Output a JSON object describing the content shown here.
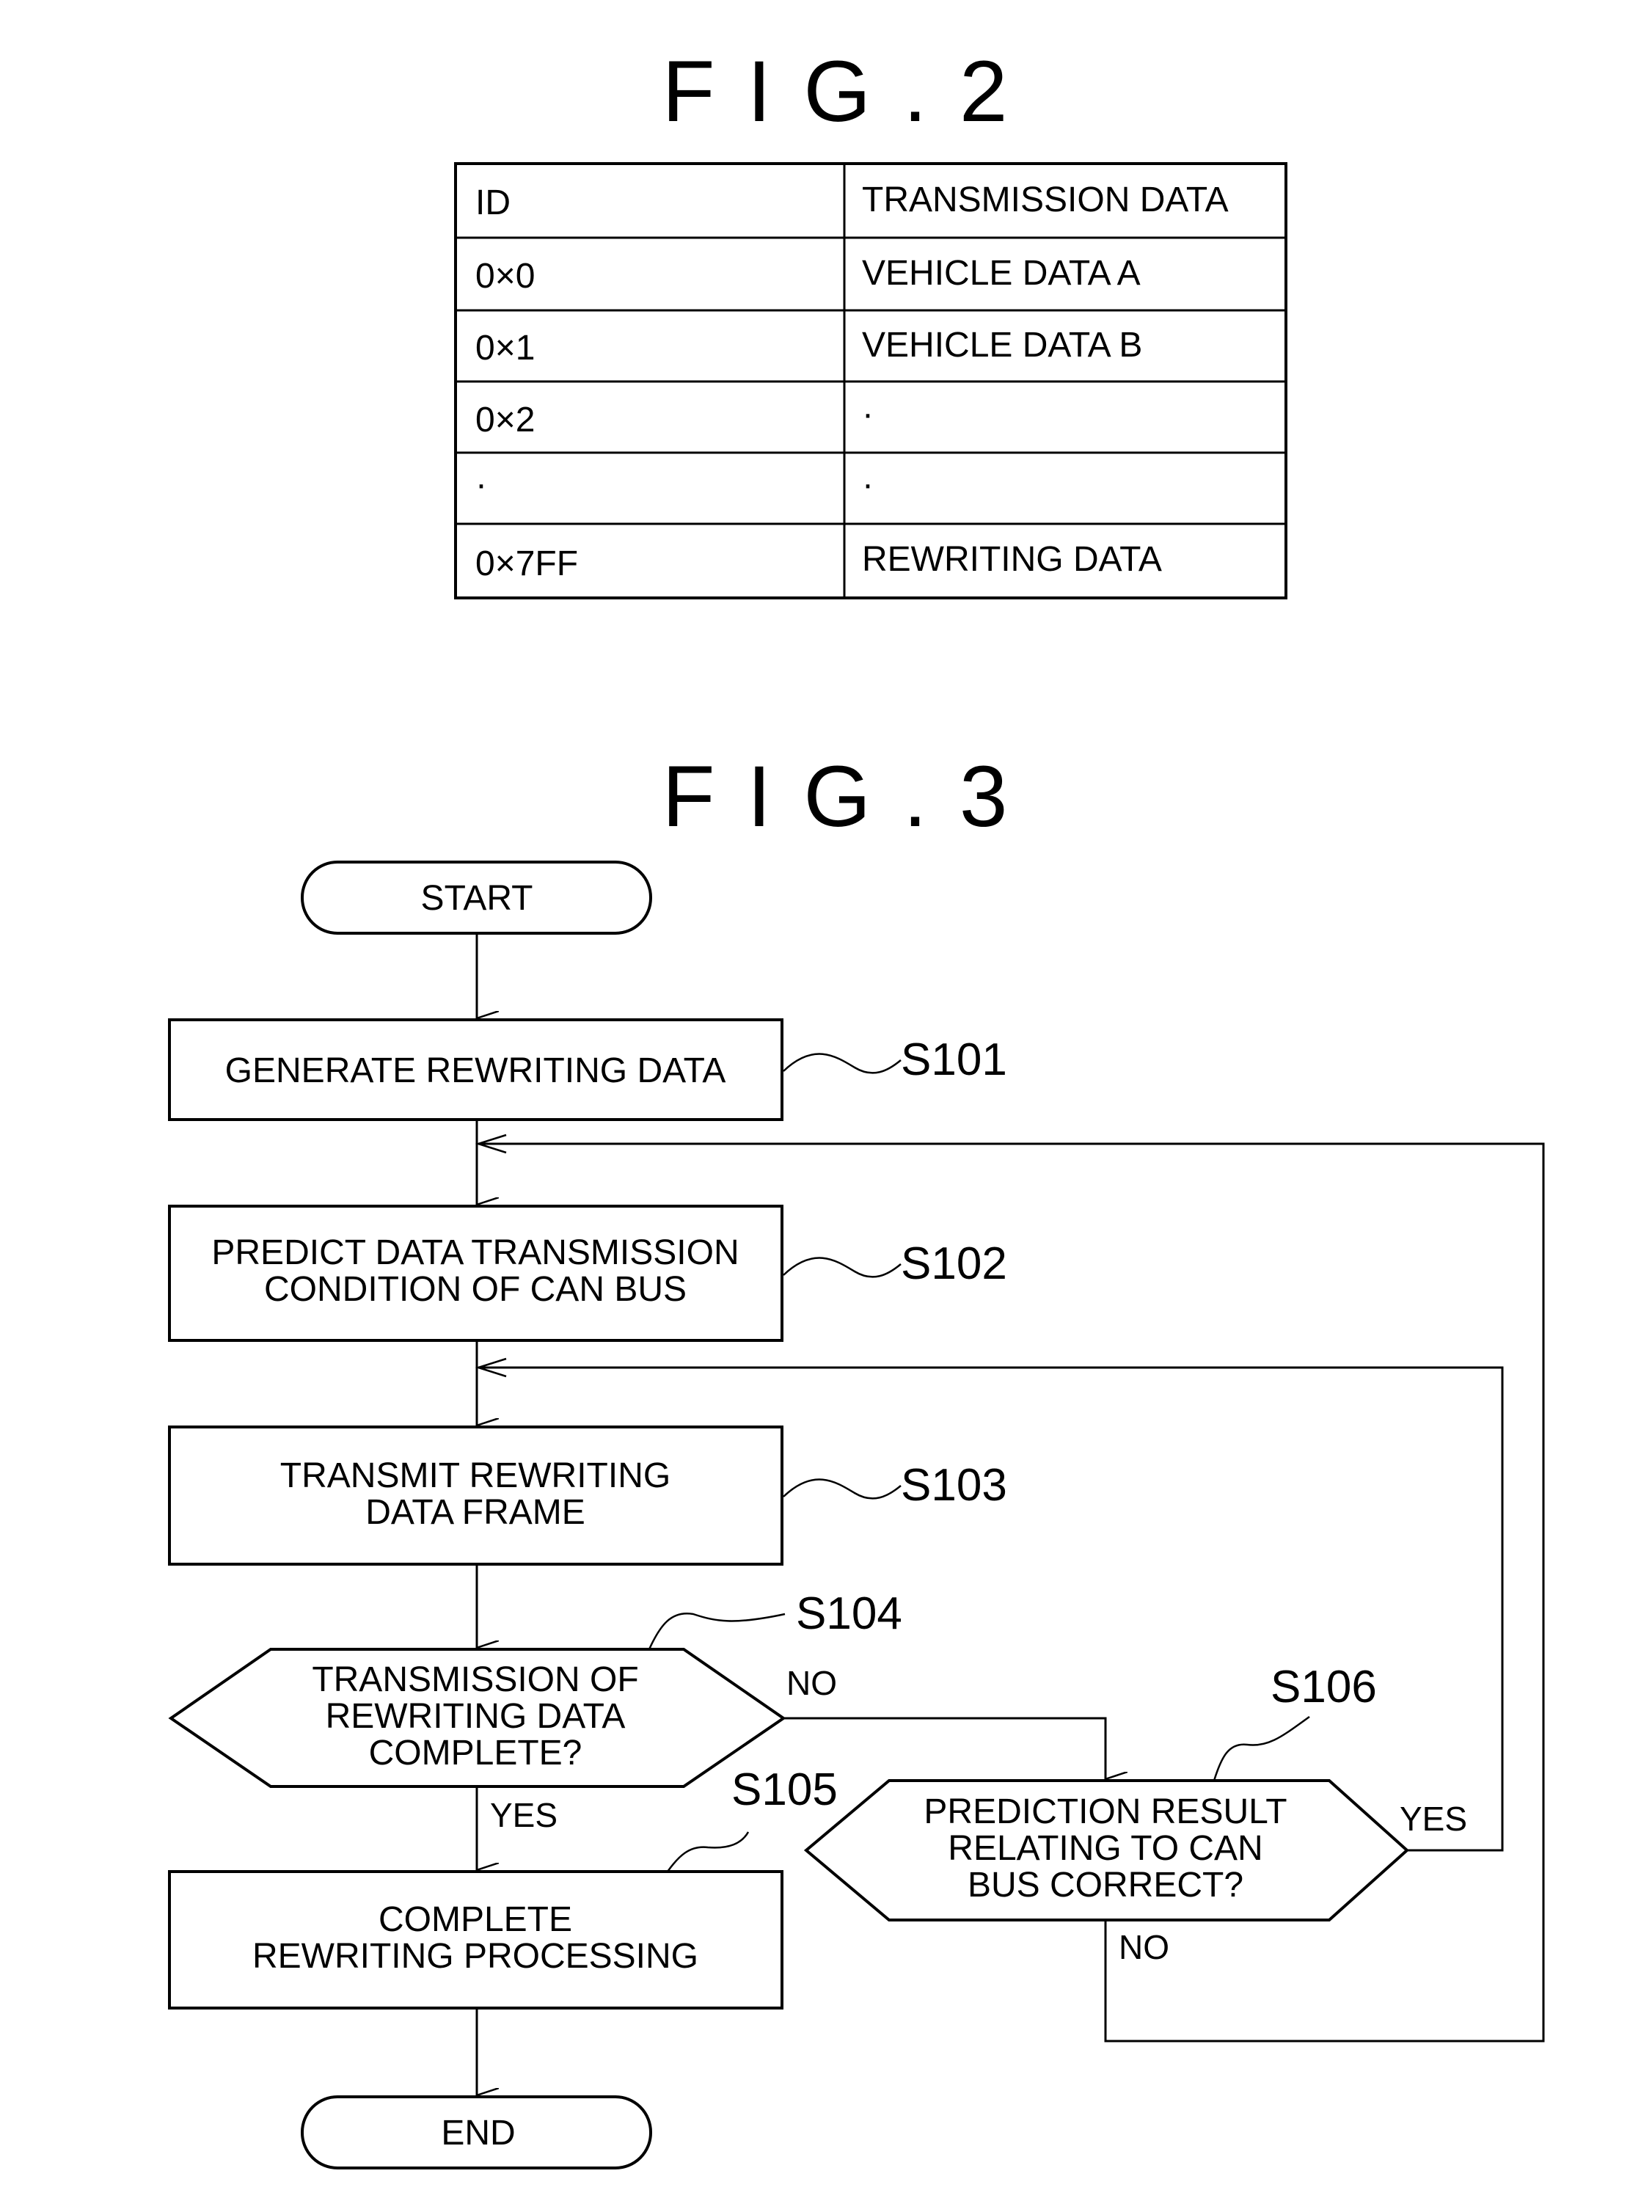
{
  "fig2": {
    "title": "FIG.2",
    "table": {
      "headers": [
        "ID",
        "TRANSMISSION DATA"
      ],
      "rows": [
        [
          "0×0",
          "VEHICLE DATA A"
        ],
        [
          "0×1",
          "VEHICLE DATA B"
        ],
        [
          "0×2",
          "·"
        ],
        [
          "·",
          "·"
        ],
        [
          "0×7FF",
          "REWRITING DATA"
        ]
      ]
    }
  },
  "fig3": {
    "title": "FIG.3",
    "start": "START",
    "end": "END",
    "steps": {
      "s101": {
        "id": "S101",
        "lines": [
          "GENERATE REWRITING DATA"
        ]
      },
      "s102": {
        "id": "S102",
        "lines": [
          "PREDICT DATA TRANSMISSION",
          "CONDITION OF CAN BUS"
        ]
      },
      "s103": {
        "id": "S103",
        "lines": [
          "TRANSMIT REWRITING",
          "DATA FRAME"
        ]
      },
      "s104": {
        "id": "S104",
        "lines": [
          "TRANSMISSION OF",
          "REWRITING DATA",
          "COMPLETE?"
        ]
      },
      "s105": {
        "id": "S105",
        "lines": [
          "COMPLETE",
          "REWRITING PROCESSING"
        ]
      },
      "s106": {
        "id": "S106",
        "lines": [
          "PREDICTION RESULT",
          "RELATING TO CAN",
          "BUS CORRECT?"
        ]
      }
    },
    "branch_labels": {
      "s104_no": "NO",
      "s104_yes": "YES",
      "s106_yes": "YES",
      "s106_no": "NO"
    }
  }
}
